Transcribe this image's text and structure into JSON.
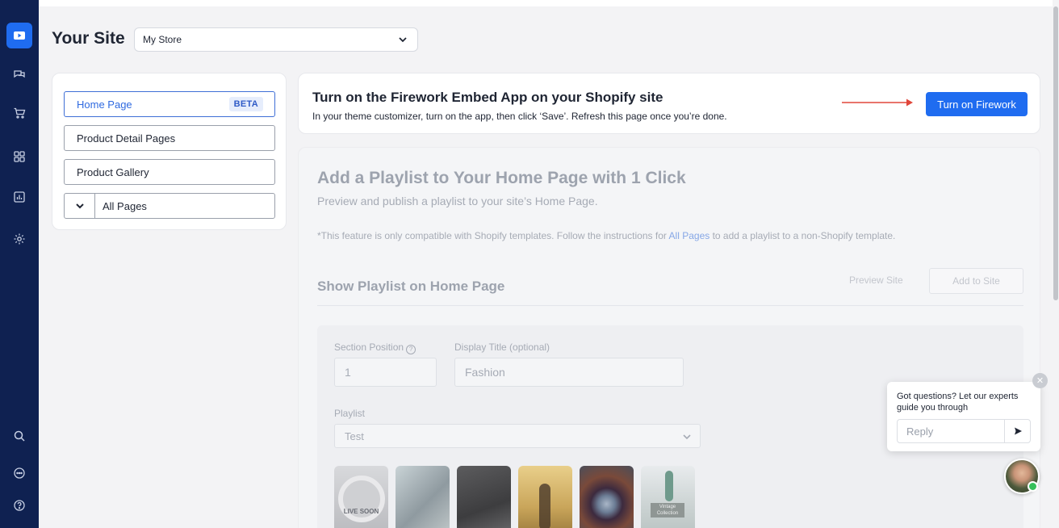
{
  "header": {
    "title": "Your Site",
    "store_select_value": "My Store"
  },
  "pages_panel": {
    "items": [
      {
        "label": "Home Page",
        "badge": "BETA",
        "active": true
      },
      {
        "label": "Product Detail Pages"
      },
      {
        "label": "Product Gallery"
      },
      {
        "label": "All Pages",
        "expandable": true
      }
    ]
  },
  "banner": {
    "title": "Turn on the Firework Embed App on your Shopify site",
    "subtitle": "In your theme customizer, turn on the app, then click ‘Save’. Refresh this page once you’re done.",
    "button_label": "Turn on Firework"
  },
  "main": {
    "heading": "Add a Playlist to Your Home Page with 1 Click",
    "subheading": "Preview and publish a playlist to your site’s Home Page.",
    "note_before": "*This feature is only compatible with Shopify templates. Follow the instructions for ",
    "note_link": "All Pages",
    "note_after": " to add a playlist to a non-Shopify template.",
    "section_title": "Show Playlist on Home Page",
    "preview_label": "Preview Site",
    "add_label": "Add to Site",
    "form": {
      "position_label": "Section Position",
      "position_value": "1",
      "display_title_label": "Display Title (optional)",
      "display_title_value": "Fashion",
      "playlist_label": "Playlist",
      "playlist_value": "Test"
    },
    "thumbnails": [
      {
        "caption": "LIVE SOON"
      },
      {
        "caption": ""
      },
      {
        "caption": ""
      },
      {
        "caption": ""
      },
      {
        "caption": ""
      },
      {
        "caption": "Vintage Collection"
      }
    ]
  },
  "chat": {
    "message": "Got questions? Let our experts guide you through",
    "input_placeholder": "Reply"
  },
  "colors": {
    "nav_bg": "#0f2151",
    "accent": "#1f6cf0",
    "arrow": "#e0463a"
  },
  "icons": {
    "rail": [
      "video-icon",
      "chat-bubbles-icon",
      "cart-icon",
      "apps-grid-icon",
      "analytics-icon",
      "settings-gear-icon",
      "search-icon",
      "messages-icon",
      "help-icon"
    ]
  }
}
